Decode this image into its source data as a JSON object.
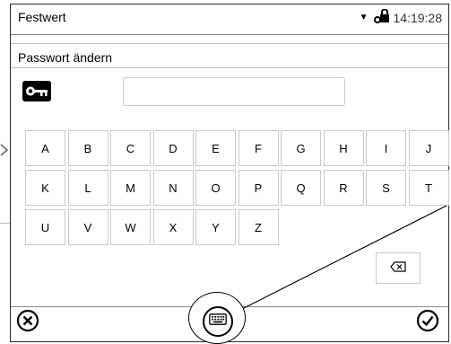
{
  "status": {
    "title": "Festwert",
    "time": "14:19:28",
    "dropdown_icon": "triangle-down-icon",
    "lock_icon": "key-lock-icon"
  },
  "dialog": {
    "title": "Passwort ändern",
    "key_icon": "key-icon",
    "password_value": "",
    "keys_row1": [
      "A",
      "B",
      "C",
      "D",
      "E",
      "F",
      "G",
      "H",
      "I",
      "J"
    ],
    "keys_row2": [
      "K",
      "L",
      "M",
      "N",
      "O",
      "P",
      "Q",
      "R",
      "S",
      "T"
    ],
    "keys_row3": [
      "U",
      "V",
      "W",
      "X",
      "Y",
      "Z"
    ],
    "backspace_icon": "backspace-icon"
  },
  "bottom": {
    "cancel_icon": "cancel-icon",
    "keyboard_icon": "keyboard-icon",
    "confirm_icon": "confirm-icon"
  }
}
